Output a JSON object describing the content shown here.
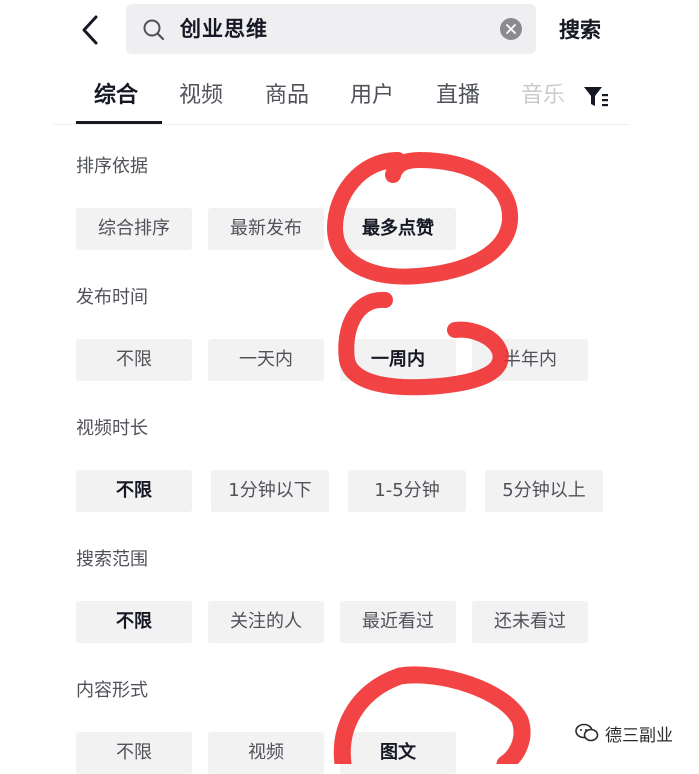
{
  "header": {
    "search_query": "创业思维",
    "search_button": "搜索"
  },
  "tabs": [
    {
      "label": "综合",
      "active": true
    },
    {
      "label": "视频"
    },
    {
      "label": "商品"
    },
    {
      "label": "用户"
    },
    {
      "label": "直播"
    },
    {
      "label": "音乐"
    }
  ],
  "filters": {
    "sort": {
      "label": "排序依据",
      "options": [
        "综合排序",
        "最新发布",
        "最多点赞"
      ],
      "selected": "最多点赞"
    },
    "publish_time": {
      "label": "发布时间",
      "options": [
        "不限",
        "一天内",
        "一周内",
        "半年内"
      ],
      "selected": "一周内"
    },
    "duration": {
      "label": "视频时长",
      "options": [
        "不限",
        "1分钟以下",
        "1-5分钟",
        "5分钟以上"
      ],
      "selected": "不限"
    },
    "scope": {
      "label": "搜索范围",
      "options": [
        "不限",
        "关注的人",
        "最近看过",
        "还未看过"
      ],
      "selected": "不限"
    },
    "content_type": {
      "label": "内容形式",
      "options": [
        "不限",
        "视频",
        "图文"
      ],
      "selected": "图文"
    }
  },
  "annotation_color": "#f02a2a",
  "watermark": {
    "text": "德三副业"
  },
  "icons": [
    "back-arrow-icon",
    "search-icon",
    "clear-icon",
    "filter-icon",
    "wechat-icon"
  ]
}
